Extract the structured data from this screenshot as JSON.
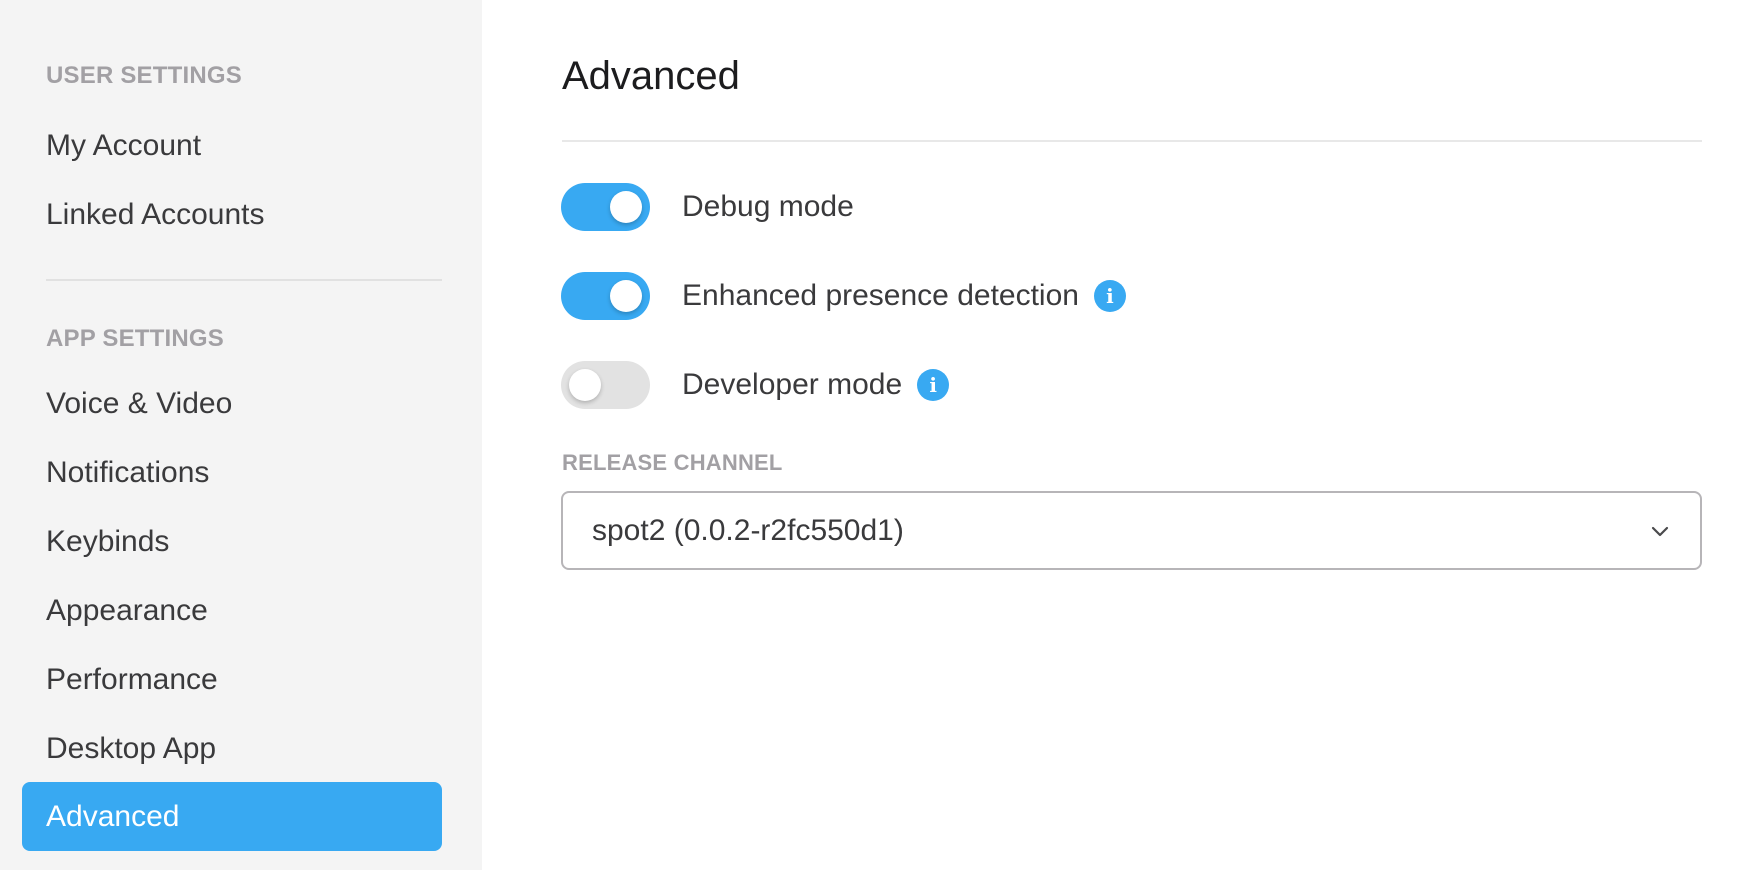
{
  "sidebar": {
    "sections": [
      {
        "heading": "User Settings",
        "items": [
          {
            "label": "My Account",
            "active": false
          },
          {
            "label": "Linked Accounts",
            "active": false
          }
        ]
      },
      {
        "heading": "App Settings",
        "items": [
          {
            "label": "Voice & Video",
            "active": false
          },
          {
            "label": "Notifications",
            "active": false
          },
          {
            "label": "Keybinds",
            "active": false
          },
          {
            "label": "Appearance",
            "active": false
          },
          {
            "label": "Performance",
            "active": false
          },
          {
            "label": "Desktop App",
            "active": false
          },
          {
            "label": "Advanced",
            "active": true
          }
        ]
      }
    ]
  },
  "main": {
    "title": "Advanced",
    "settings": [
      {
        "label": "Debug mode",
        "enabled": true,
        "info_icon": false
      },
      {
        "label": "Enhanced presence detection",
        "enabled": true,
        "info_icon": true
      },
      {
        "label": "Developer mode",
        "enabled": false,
        "info_icon": true
      }
    ],
    "release_channel": {
      "label": "Release Channel",
      "selected": "spot2 (0.0.2-r2fc550d1)"
    }
  },
  "icons": {
    "info": "i",
    "dropdown": "chevron-down-icon"
  },
  "colors": {
    "accent": "#38a9f2",
    "sidebar_bg": "#f4f4f4",
    "heading_gray": "#a2a0a4",
    "toggle_off": "#e2e2e2"
  }
}
